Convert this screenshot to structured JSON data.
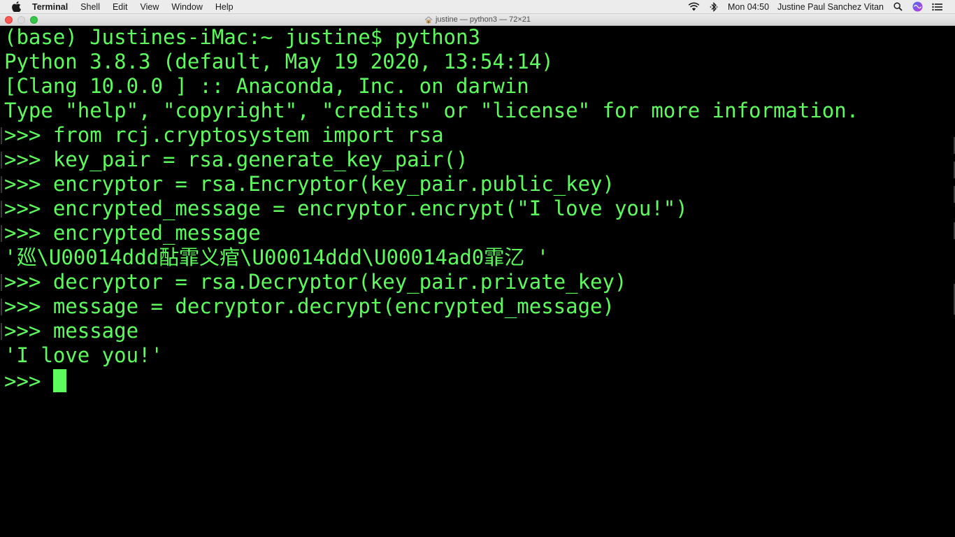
{
  "menubar": {
    "apple_icon": "apple-logo-icon",
    "app_name": "Terminal",
    "items": [
      "Shell",
      "Edit",
      "View",
      "Window",
      "Help"
    ],
    "status_icons": [
      "wifi-icon",
      "bluetooth-icon"
    ],
    "clock": "Mon 04:50",
    "user": "Justine Paul Sanchez Vitan",
    "right_icons": [
      "search-icon",
      "siri-icon",
      "notification-center-icon"
    ]
  },
  "window": {
    "title": "justine — python3 — 72×21",
    "title_icon": "home-folder-icon"
  },
  "terminal": {
    "text_color": "#5cfc5c",
    "background": "#000000",
    "lines": [
      "(base) Justines-iMac:~ justine$ python3",
      "Python 3.8.3 (default, May 19 2020, 13:54:14)",
      "[Clang 10.0.0 ] :: Anaconda, Inc. on darwin",
      "Type \"help\", \"copyright\", \"credits\" or \"license\" for more information.",
      ">>> from rcj.cryptosystem import rsa",
      ">>> key_pair = rsa.generate_key_pair()",
      ">>> encryptor = rsa.Encryptor(key_pair.public_key)",
      ">>> encrypted_message = encryptor.encrypt(\"I love you!\")",
      ">>> encrypted_message",
      "'廵\\U00014ddd酟霏义痯\\U00014ddd\\U00014ad0霏㲸 '",
      ">>> decryptor = rsa.Decryptor(key_pair.private_key)",
      ">>> message = decryptor.decrypt(encrypted_message)",
      ">>> message",
      "'I love you!'"
    ],
    "current_prompt": ">>> "
  }
}
